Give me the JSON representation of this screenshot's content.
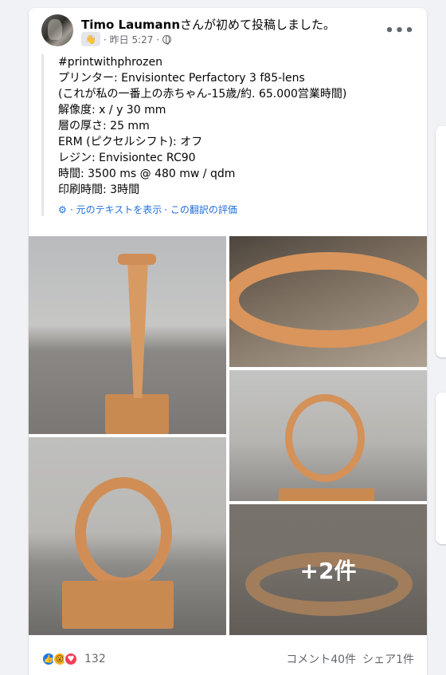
{
  "post": {
    "author": {
      "name": "Timo Laumann",
      "suffix": "さんが初めて投稿しました。"
    },
    "meta": {
      "time": "· 昨日 5:27 ·",
      "badge_icon": "wave-icon",
      "privacy_icon": "globe-icon"
    },
    "more_button": "•••",
    "text_lines": [
      "#printwithphrozen",
      "プリンター: Envisiontec Perfactory 3 f85-lens",
      "(これが私の一番上の赤ちゃん-15歳/約. 65.000営業時間)",
      "解像度: x / y 30 mm",
      "層の厚さ: 25 mm",
      "ERM (ピクセルシフト): オフ",
      "レジン: Envisiontec RC90",
      "時間: 3500 ms @ 480 mw / qdm",
      "印刷時間: 3時間"
    ],
    "translation": {
      "icon": "gear-icon",
      "show_original": "· 元のテキストを表示",
      "rate": "· この翻訳の評価"
    },
    "photos": {
      "more_count": "+2件"
    },
    "footer": {
      "reaction_icons": [
        "like-icon",
        "wow-icon",
        "love-icon"
      ],
      "reaction_count": "132",
      "comments": "コメント40件",
      "shares": "シェア1件"
    }
  },
  "colors": {
    "link": "#216fdb",
    "resin": "#d9935a",
    "like": "#1877f2",
    "love": "#f33e58",
    "wow": "#f7b125"
  }
}
